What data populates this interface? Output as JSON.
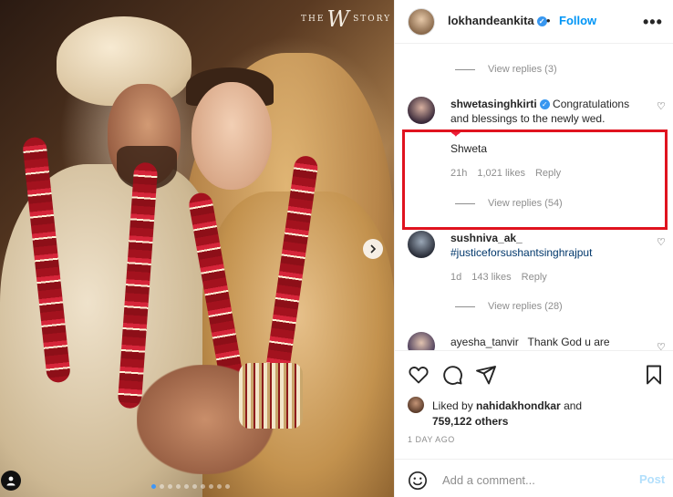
{
  "photo": {
    "watermark_prefix": "THE",
    "watermark_letter": "W",
    "watermark_suffix": "STORY",
    "carousel_count": 10,
    "carousel_active_index": 0
  },
  "header": {
    "username": "lokhandeankita",
    "separator": "•",
    "follow_label": "Follow",
    "more_icon": "more-options-icon"
  },
  "comments": {
    "view_replies_1": "View replies (3)",
    "view_replies_2": "View replies (54)",
    "view_replies_3": "View replies (28)",
    "items": [
      {
        "user": "shwetasinghkirti",
        "verified": true,
        "text": "Congratulations and blessings to the newly wed.",
        "emoji": "❤",
        "signature": "Shweta",
        "time": "21h",
        "likes": "1,021 likes",
        "reply": "Reply"
      },
      {
        "user": "sushniva_ak_",
        "text": "#justiceforsushantsinghrajput",
        "time": "1d",
        "likes": "143 likes",
        "reply": "Reply"
      },
      {
        "user": "ayesha_tanvir",
        "text": "Thank God u are"
      }
    ]
  },
  "actions": {
    "liked_by_prefix": "Liked by",
    "liked_by_user": "nahidakhondkar",
    "liked_by_and": "and",
    "others": "759,122 others",
    "time_ago": "1 DAY AGO"
  },
  "add_comment": {
    "placeholder": "Add a comment...",
    "post_label": "Post"
  },
  "colors": {
    "link_blue": "#0095f6",
    "highlight_red": "#e0131f",
    "verified_blue": "#3897f0",
    "post_disabled": "#b2dffc"
  }
}
